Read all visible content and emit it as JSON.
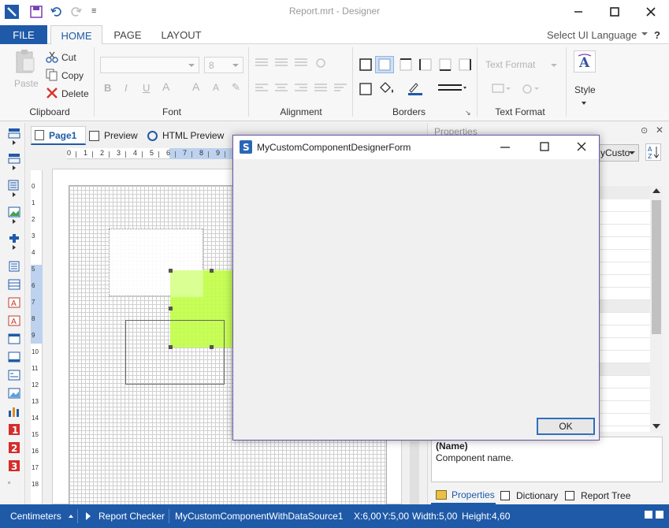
{
  "window": {
    "title": "Report.mrt - Designer"
  },
  "menu": {
    "file": "FILE",
    "tabs": [
      "HOME",
      "PAGE",
      "LAYOUT"
    ],
    "ui_language": "Select UI Language",
    "help": "?"
  },
  "ribbon": {
    "clipboard": {
      "paste": "Paste",
      "cut": "Cut",
      "copy": "Copy",
      "delete": "Delete",
      "label": "Clipboard"
    },
    "font": {
      "size": "8",
      "label": "Font"
    },
    "alignment": {
      "label": "Alignment"
    },
    "borders": {
      "label": "Borders"
    },
    "text_format": {
      "combo": "Text Format",
      "label": "Text Format"
    },
    "style": {
      "label": "Style"
    }
  },
  "page_tabs": {
    "page1": "Page1",
    "preview": "Preview",
    "html_preview": "HTML Preview"
  },
  "ruler": {
    "horizontal": [
      "0",
      "1",
      "2",
      "3",
      "4",
      "5",
      "6",
      "7",
      "8",
      "9"
    ],
    "vertical": [
      "0",
      "1",
      "2",
      "3",
      "4",
      "5",
      "6",
      "7",
      "8",
      "9",
      "10",
      "11",
      "12",
      "13",
      "14",
      "15",
      "16",
      "17",
      "18"
    ]
  },
  "properties": {
    "title": "Properties",
    "combo_value": "yCusto",
    "desc_name": "(Name)",
    "desc_text": "Component name.",
    "tabs": {
      "properties": "Properties",
      "dictionary": "Dictionary",
      "report_tree": "Report Tree"
    }
  },
  "dialog": {
    "title": "MyCustomComponentDesignerForm",
    "ok": "OK"
  },
  "status": {
    "units": "Centimeters",
    "checker": "Report Checker",
    "component": "MyCustomComponentWithDataSource1",
    "x": "X:6,00",
    "y": "Y:5,00",
    "width": "Width:5,00",
    "height": "Height:4,60"
  },
  "colors": {
    "accent": "#1f5aa8",
    "highlight": "#c2ff4a",
    "dialog_border": "#6b54a8"
  }
}
